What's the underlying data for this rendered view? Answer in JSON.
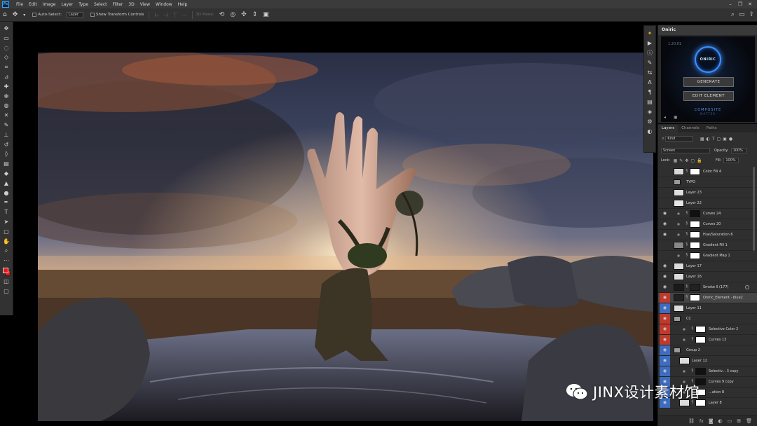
{
  "app": {
    "logo": "Ps"
  },
  "menu": [
    "File",
    "Edit",
    "Image",
    "Layer",
    "Type",
    "Select",
    "Filter",
    "3D",
    "View",
    "Window",
    "Help"
  ],
  "options_bar": {
    "auto_select_label": "Auto-Select:",
    "auto_select_value": "Layer",
    "transform_label": "Show Transform Controls",
    "mode_3d_label": "3D Mode:"
  },
  "tools": [
    "move-tool",
    "artboard-tool",
    "lasso-tool",
    "polygonal-lasso-tool",
    "crop-tool",
    "eyedropper-tool",
    "spot-healing-tool",
    "healing-brush-tool",
    "patch-tool",
    "content-aware-tool",
    "brush-tool",
    "clone-stamp-tool",
    "history-brush-tool",
    "eraser-tool",
    "gradient-tool",
    "blur-tool",
    "sharpen-tool",
    "dodge-tool",
    "pen-tool",
    "type-tool",
    "path-selection-tool",
    "rectangle-tool",
    "hand-tool",
    "zoom-tool",
    "more-tools"
  ],
  "colors": {
    "foreground": "#e8141b",
    "background": "#e8141b",
    "accent": "#3d8fff",
    "ui_dark": "#323232"
  },
  "oniric": {
    "tab": "Oniric",
    "version": "1.20.01",
    "ring_text": "ONIRIC",
    "generate_label": "GENERATE",
    "edit_label": "EDIT ELEMENT",
    "brand_line1": "COMPOSITE",
    "brand_line2": "MATTER"
  },
  "layers_panel": {
    "tabs": [
      "Layers",
      "Channels",
      "Paths"
    ],
    "filter_kind": "Kind",
    "blend_mode": "Screen",
    "opacity_label": "Opacity:",
    "opacity_value": "100%",
    "lock_label": "Lock:",
    "fill_label": "Fill:",
    "fill_value": "100%",
    "layers": [
      {
        "name": "Color Fill 4",
        "eye": "",
        "eye_bg": "",
        "indent": 0,
        "thumb": "#d8d8d8",
        "mask": true,
        "selected": false
      },
      {
        "name": "TYPO",
        "eye": "",
        "eye_bg": "",
        "indent": 0,
        "thumb": "folder",
        "mask": false,
        "selected": false
      },
      {
        "name": "Layer 23",
        "eye": "",
        "eye_bg": "",
        "indent": 0,
        "thumb": "#e0e0e0",
        "mask": false,
        "selected": false
      },
      {
        "name": "Layer 22",
        "eye": "",
        "eye_bg": "",
        "indent": 0,
        "thumb": "#e6e6e6",
        "mask": false,
        "selected": false
      },
      {
        "name": "Curves 24",
        "eye": "◉",
        "eye_bg": "",
        "indent": 0,
        "thumb": "adj",
        "mask": true,
        "mask_color": "#111",
        "selected": false
      },
      {
        "name": "Curves 20",
        "eye": "◉",
        "eye_bg": "",
        "indent": 0,
        "thumb": "adj",
        "mask": true,
        "selected": false
      },
      {
        "name": "Hue/Saturation 6",
        "eye": "◉",
        "eye_bg": "",
        "indent": 0,
        "thumb": "adj",
        "mask": true,
        "selected": false
      },
      {
        "name": "Gradient Fill 1",
        "eye": "",
        "eye_bg": "",
        "indent": 0,
        "thumb": "#888",
        "mask": true,
        "selected": false
      },
      {
        "name": "Gradient Map 1",
        "eye": "",
        "eye_bg": "",
        "indent": 0,
        "thumb": "adj",
        "mask": true,
        "selected": false
      },
      {
        "name": "Layer 17",
        "eye": "◉",
        "eye_bg": "",
        "indent": 0,
        "thumb": "#dcdcdc",
        "mask": false,
        "selected": false
      },
      {
        "name": "Layer 16",
        "eye": "◉",
        "eye_bg": "",
        "indent": 0,
        "thumb": "#dcdcdc",
        "mask": false,
        "selected": false
      },
      {
        "name": "Smoke II (177)",
        "eye": "◉",
        "eye_bg": "",
        "indent": 0,
        "thumb": "#1a1a1a",
        "mask": true,
        "mask_color": "#222",
        "selected": false
      },
      {
        "name": "Oniric_Element - blue2",
        "eye": "◉",
        "eye_bg": "#c0392b",
        "indent": 0,
        "thumb": "#222",
        "mask": true,
        "selected": true
      },
      {
        "name": "Layer 11",
        "eye": "◉",
        "eye_bg": "#3d6cc0",
        "indent": 0,
        "thumb": "#dcdcdc",
        "mask": false,
        "selected": false
      },
      {
        "name": "CC",
        "eye": "◉",
        "eye_bg": "#c0392b",
        "indent": 0,
        "thumb": "folder",
        "mask": false,
        "selected": false
      },
      {
        "name": "Selective Color 2",
        "eye": "◉",
        "eye_bg": "#c0392b",
        "indent": 1,
        "thumb": "adj",
        "mask": true,
        "selected": false
      },
      {
        "name": "Curves 13",
        "eye": "◉",
        "eye_bg": "#c0392b",
        "indent": 1,
        "thumb": "adj",
        "mask": true,
        "selected": false
      },
      {
        "name": "Group 2",
        "eye": "◉",
        "eye_bg": "#3d6cc0",
        "indent": 0,
        "thumb": "folder",
        "mask": false,
        "selected": false
      },
      {
        "name": "Layer 12",
        "eye": "◉",
        "eye_bg": "#3d6cc0",
        "indent": 1,
        "thumb": "#dcdcdc",
        "mask": false,
        "selected": false
      },
      {
        "name": "Selectiv... 3 copy",
        "eye": "◉",
        "eye_bg": "#3d6cc0",
        "indent": 1,
        "thumb": "adj",
        "mask": true,
        "mask_color": "#111",
        "selected": false
      },
      {
        "name": "Curves 9 copy",
        "eye": "◉",
        "eye_bg": "#3d6cc0",
        "indent": 1,
        "thumb": "adj",
        "mask": true,
        "mask_color": "#111",
        "selected": false
      },
      {
        "name": "...ation 8",
        "eye": "◉",
        "eye_bg": "#3d6cc0",
        "indent": 1,
        "thumb": "adj",
        "mask": true,
        "selected": false
      },
      {
        "name": "Layer 8",
        "eye": "◉",
        "eye_bg": "#3d6cc0",
        "indent": 1,
        "thumb": "#dcdcdc",
        "mask": true,
        "selected": false
      }
    ]
  },
  "watermark": {
    "text": "JINX设计素材馆"
  }
}
